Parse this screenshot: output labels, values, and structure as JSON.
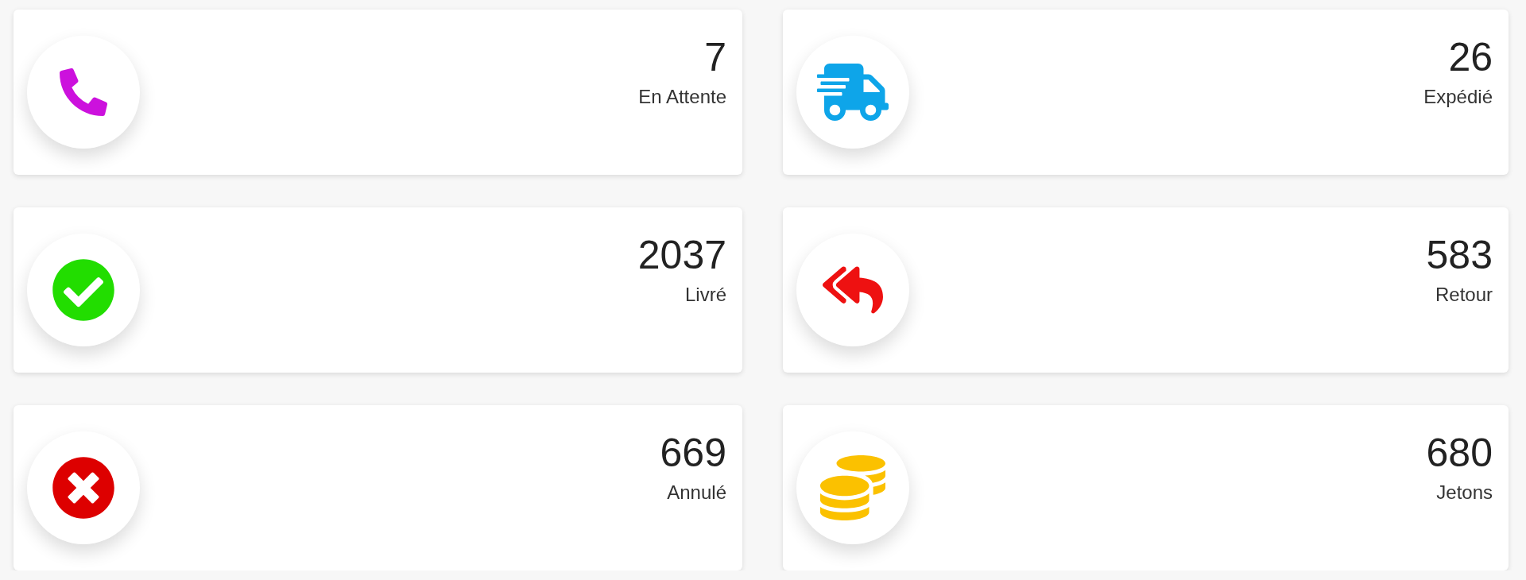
{
  "cards": [
    {
      "kind": "phone",
      "color": "#cc11dd",
      "value": "7",
      "label": "En Attente"
    },
    {
      "kind": "truck",
      "color": "#0ea5e9",
      "value": "26",
      "label": "Expédié"
    },
    {
      "kind": "check",
      "color": "#22dd00",
      "value": "2037",
      "label": "Livré"
    },
    {
      "kind": "reply",
      "color": "#ee1111",
      "value": "583",
      "label": "Retour"
    },
    {
      "kind": "cancel",
      "color": "#dd0000",
      "value": "669",
      "label": "Annulé"
    },
    {
      "kind": "coins",
      "color": "#fbc100",
      "value": "680",
      "label": "Jetons"
    }
  ]
}
